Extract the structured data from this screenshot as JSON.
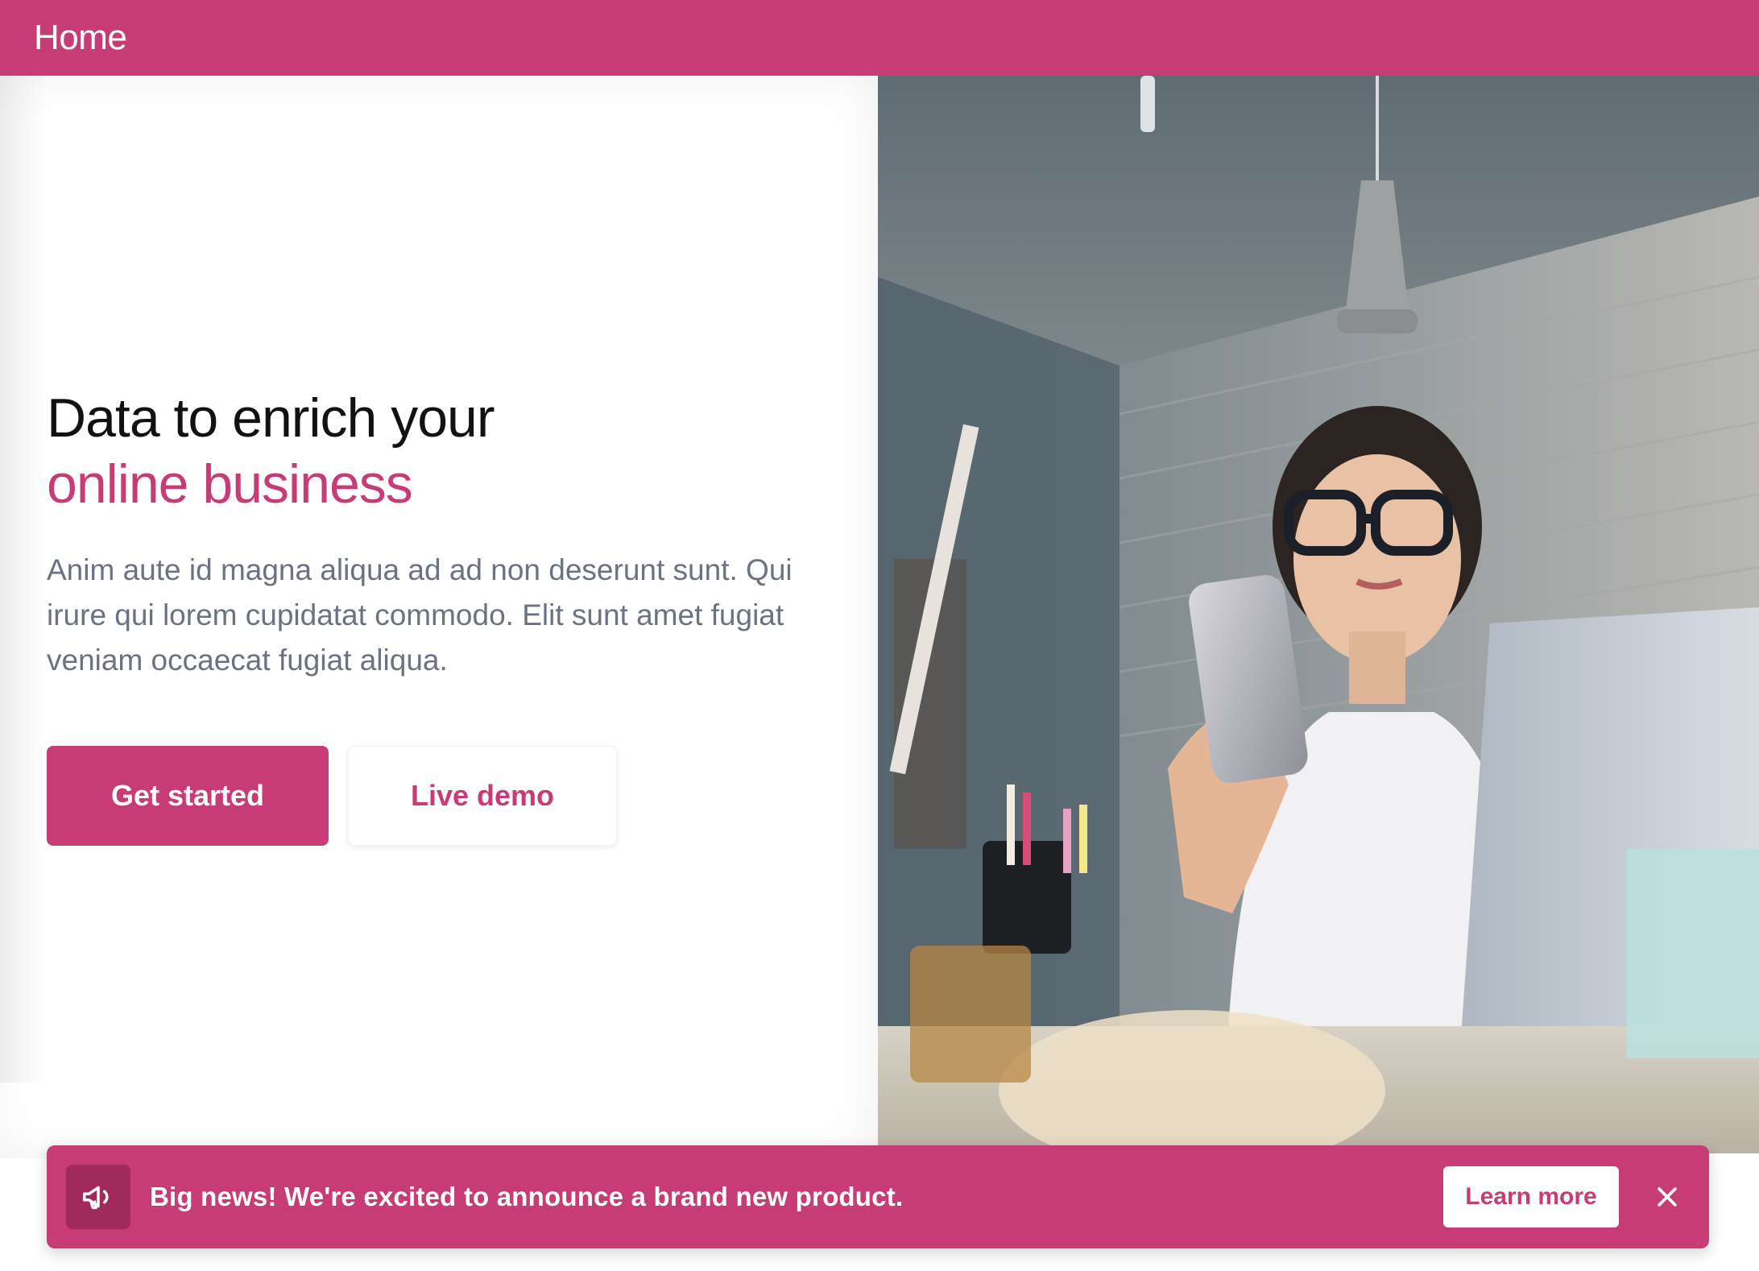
{
  "navbar": {
    "title": "Home"
  },
  "hero": {
    "headline_line1": "Data to enrich your",
    "headline_accent": "online business",
    "description": "Anim aute id magna aliqua ad ad non deserunt sunt. Qui irure qui lorem cupidatat commodo. Elit sunt amet fugiat veniam occaecat fugiat aliqua.",
    "primary_button": "Get started",
    "secondary_button": "Live demo",
    "image_icon": "photo-woman-phone-laptop"
  },
  "banner": {
    "icon": "megaphone-icon",
    "message": "Big news! We're excited to announce a brand new product.",
    "cta": "Learn more",
    "close_icon": "close-icon"
  },
  "colors": {
    "brand": "#c73b76",
    "brand_dark": "#a02a5b",
    "text_dark": "#111111",
    "text_muted": "#6b7280",
    "white": "#ffffff"
  }
}
